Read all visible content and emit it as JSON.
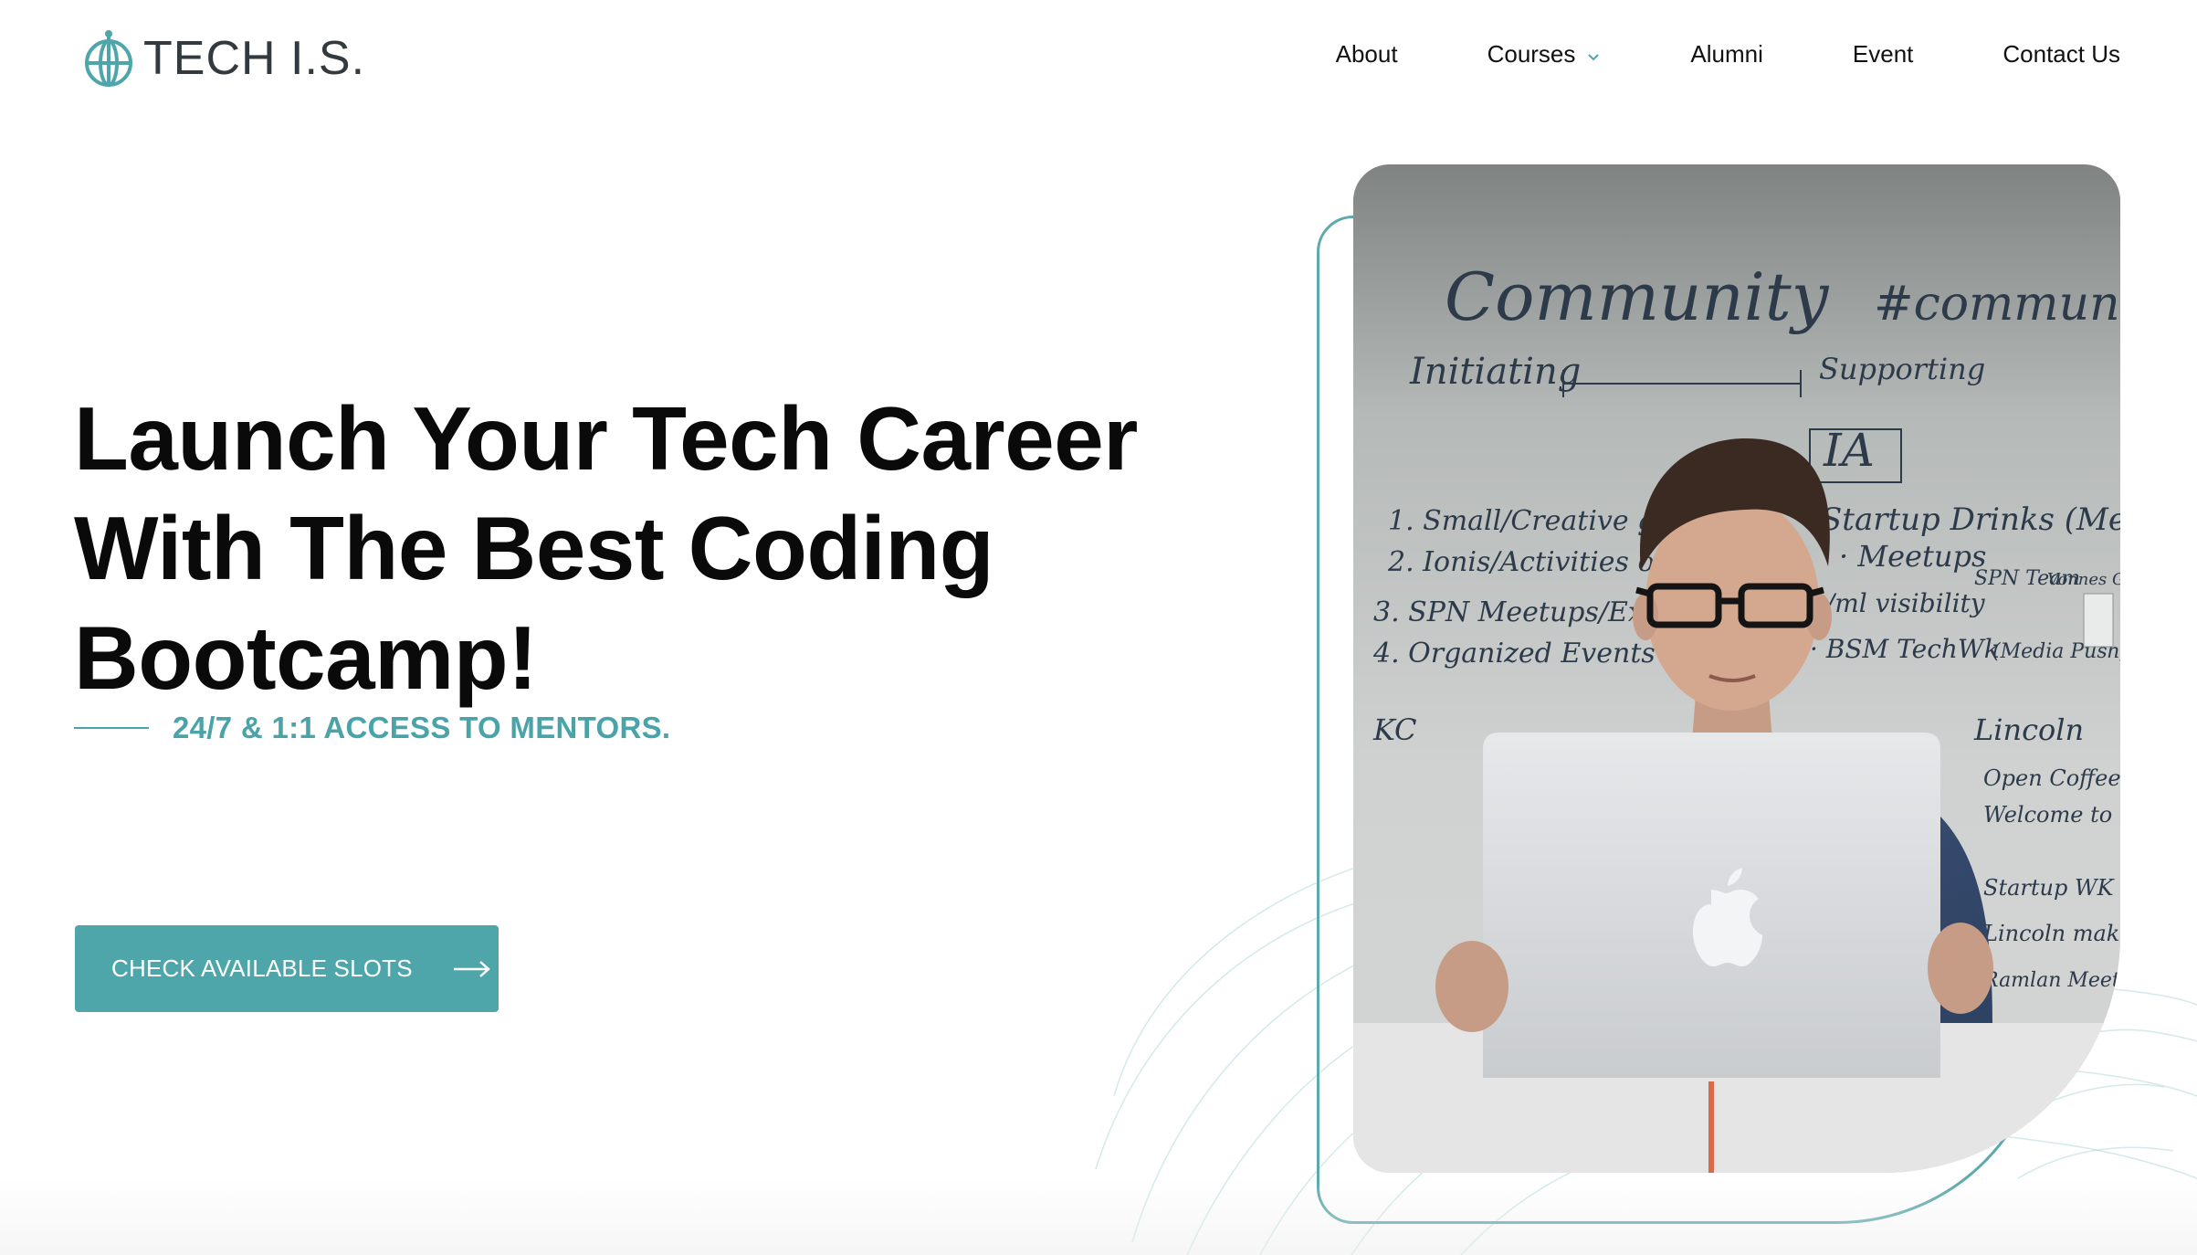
{
  "brand": {
    "name": "TECH I.S.",
    "accent_color": "#4fa6aa",
    "text_color": "#333a3f"
  },
  "nav": {
    "items": [
      {
        "label": "About",
        "has_dropdown": false
      },
      {
        "label": "Courses",
        "has_dropdown": true
      },
      {
        "label": "Alumni",
        "has_dropdown": false
      },
      {
        "label": "Event",
        "has_dropdown": false
      },
      {
        "label": "Contact Us",
        "has_dropdown": false
      }
    ],
    "dropdown_icon": "chevron-down-icon"
  },
  "hero": {
    "title_lines": [
      "Launch Your Tech Career",
      "With The Best Coding",
      "Bootcamp!"
    ],
    "subtitle": "24/7 & 1:1 ACCESS TO MENTORS.",
    "cta_label": "CHECK AVAILABLE SLOTS",
    "cta_icon": "arrow-right-icon"
  },
  "photo": {
    "whiteboard_text": {
      "heading_left": "Community",
      "heading_right": "#community",
      "initiating": "Initiating",
      "supporting": "Supporting",
      "ia": "IA",
      "list_left": [
        "1. Small/Creative group",
        "2. Ionis/Activities org",
        "3. SPN Meetups/Expert",
        "4. Organized Events"
      ],
      "kc": "KC",
      "list_right": [
        "Startup Drinks (Megan)",
        "· Meetups",
        "· /ml visibility",
        "· BSM TechWk",
        "Lincoln",
        "Open Coffees",
        "Welcome to happy",
        "Startup WK",
        "Lincoln make",
        "Ramlan Meet"
      ],
      "side_notes": [
        "SPN Team",
        "Vonnes GSL",
        "(Media Push)"
      ]
    }
  }
}
